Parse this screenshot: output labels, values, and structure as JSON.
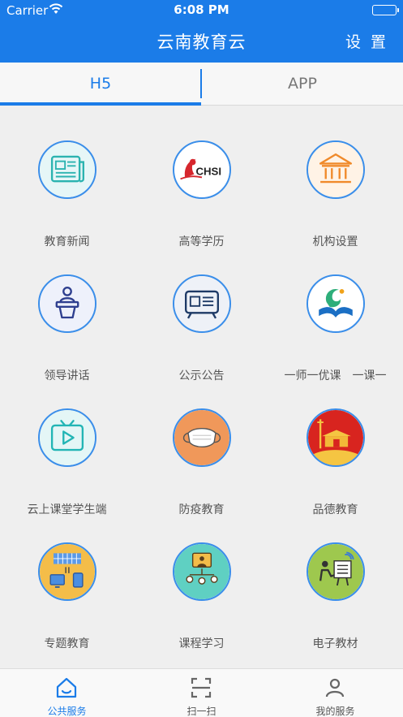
{
  "status_bar": {
    "carrier": "Carrier",
    "time": "6:08 PM"
  },
  "header": {
    "title": "云南教育云",
    "settings_label": "设 置"
  },
  "tabs": [
    {
      "label": "H5"
    },
    {
      "label": "APP"
    }
  ],
  "grid_items": [
    {
      "label": "教育新闻",
      "icon": "newspaper-icon"
    },
    {
      "label": "高等学历",
      "icon": "chsi-logo-icon",
      "logo_text": "CHSI"
    },
    {
      "label": "机构设置",
      "icon": "institution-building-icon"
    },
    {
      "label": "领导讲话",
      "icon": "speaker-podium-icon"
    },
    {
      "label": "公示公告",
      "icon": "notice-board-icon"
    },
    {
      "label": "一师一优课　一课一",
      "icon": "education-logo-icon"
    },
    {
      "label": "云上课堂学生端",
      "icon": "tv-play-icon"
    },
    {
      "label": "防疫教育",
      "icon": "face-mask-icon"
    },
    {
      "label": "品德教育",
      "icon": "tiananmen-icon"
    },
    {
      "label": "专题教育",
      "icon": "topic-devices-icon"
    },
    {
      "label": "课程学习",
      "icon": "course-study-icon"
    },
    {
      "label": "电子教材",
      "icon": "e-textbook-icon"
    }
  ],
  "bottom_nav": [
    {
      "label": "公共服务",
      "icon": "home-icon",
      "active": true
    },
    {
      "label": "扫一扫",
      "icon": "scan-icon"
    },
    {
      "label": "我的服务",
      "icon": "user-icon"
    }
  ],
  "colors": {
    "primary": "#1b7ce8",
    "background": "#efefef",
    "icon_border": "#3a8eea"
  }
}
